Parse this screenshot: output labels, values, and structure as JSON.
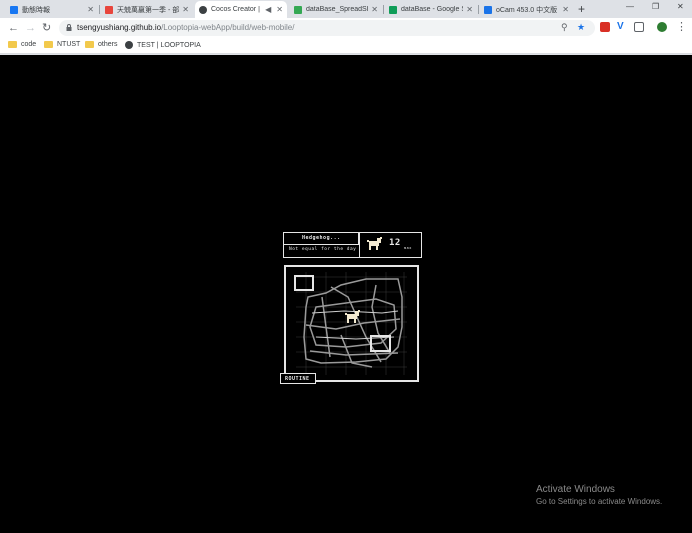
{
  "browser": {
    "tabs": [
      {
        "title": "動態時報",
        "favicon_color": "#1877f2",
        "favicon": "facebook-icon"
      },
      {
        "title": "天兢萬嬴第一季 - 部",
        "favicon_color": "#e8453c",
        "favicon": "site-icon"
      },
      {
        "title": "Cocos Creator | ",
        "favicon_color": "#3c4043",
        "favicon": "globe-icon",
        "active": true
      },
      {
        "title": "dataBase_SpreadShe",
        "favicon_color": "#34a853",
        "favicon": "drive-icon"
      },
      {
        "title": "dataBase - Google S",
        "favicon_color": "#0f9d58",
        "favicon": "sheets-icon"
      },
      {
        "title": "oCam 453.0 中文版",
        "favicon_color": "#1a73e8",
        "favicon": "ocam-icon"
      }
    ],
    "url_host": "tsengyushiang.github.io",
    "url_path": "/Looptopia-webApp/build/web-mobile/",
    "bookmarks": [
      {
        "label": "code",
        "type": "folder"
      },
      {
        "label": "NTUST",
        "type": "folder"
      },
      {
        "label": "others",
        "type": "folder"
      },
      {
        "label": "TEST | LOOPTOPIA",
        "type": "page"
      }
    ]
  },
  "game": {
    "status_title": "Hedgehog...",
    "status_subtitle": "Not equal for the day",
    "count": "12",
    "count_unit": "max",
    "routine_label": "ROUTINE"
  },
  "watermark": {
    "line1": "Activate Windows",
    "line2": "Go to Settings to activate Windows."
  },
  "colors": {
    "accent": "#1a73e8",
    "panel_stroke": "#e6e6e6"
  }
}
